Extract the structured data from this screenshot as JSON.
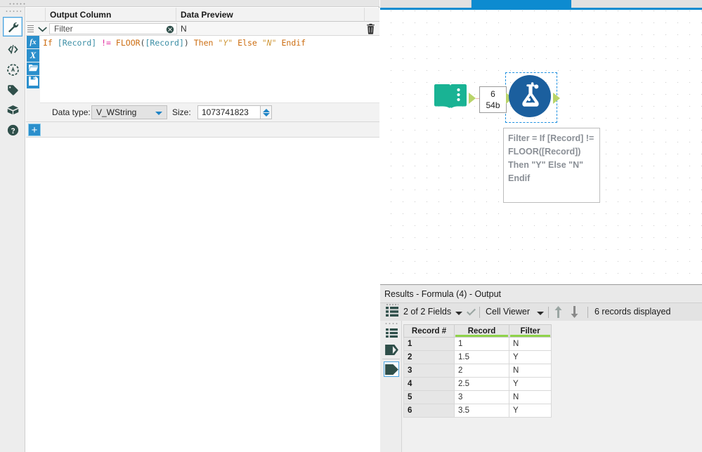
{
  "app": {
    "accent_blue": "#0d8bd0",
    "tool_blue": "#2b8fcc",
    "node_blue": "#1b5f9e",
    "node_green": "#19b394",
    "connector_green": "#b9d46a",
    "header_green": "#8fd34a"
  },
  "config": {
    "rail_icons": [
      {
        "name": "wrench-icon",
        "glyph": "wrench",
        "selected": true
      },
      {
        "name": "code-icon",
        "glyph": "code",
        "selected": false
      },
      {
        "name": "compass-icon",
        "glyph": "compass",
        "selected": false
      },
      {
        "name": "tag-icon",
        "glyph": "tag",
        "selected": false
      },
      {
        "name": "package-icon",
        "glyph": "package",
        "selected": false
      },
      {
        "name": "help-icon",
        "glyph": "question",
        "selected": false
      }
    ],
    "columns": {
      "output_column": "Output Column",
      "data_preview": "Data Preview"
    },
    "row": {
      "output_column_value": "Filter",
      "output_column_placeholder": "Filter",
      "data_preview_value": "N",
      "clear_icon": "clear-circle-icon",
      "delete_icon": "trash-icon",
      "expand_icon": "chevron-down-icon"
    },
    "editor_buttons": [
      {
        "name": "function-button",
        "label": "fx"
      },
      {
        "name": "variable-button",
        "label": "X"
      },
      {
        "name": "open-button",
        "label": "folder-icon"
      },
      {
        "name": "save-button",
        "label": "save-icon"
      }
    ],
    "formula": {
      "full_text": "If [Record] != FLOOR([Record]) Then \"Y\" Else \"N\" Endif",
      "tokens": [
        {
          "t": "If",
          "c": "kw"
        },
        {
          "t": " ",
          "c": "pl"
        },
        {
          "t": "[Record]",
          "c": "fld"
        },
        {
          "t": " ",
          "c": "pl"
        },
        {
          "t": "!=",
          "c": "op"
        },
        {
          "t": " ",
          "c": "pl"
        },
        {
          "t": "FLOOR",
          "c": "fn"
        },
        {
          "t": "(",
          "c": "pl"
        },
        {
          "t": "[Record]",
          "c": "fld"
        },
        {
          "t": ")",
          "c": "pl"
        },
        {
          "t": " ",
          "c": "pl"
        },
        {
          "t": "Then",
          "c": "kw"
        },
        {
          "t": " ",
          "c": "pl"
        },
        {
          "t": "\"Y\"",
          "c": "str"
        },
        {
          "t": " ",
          "c": "pl"
        },
        {
          "t": "Else",
          "c": "kw"
        },
        {
          "t": " ",
          "c": "pl"
        },
        {
          "t": "\"N\"",
          "c": "str"
        },
        {
          "t": " ",
          "c": "pl"
        },
        {
          "t": "Endif",
          "c": "kw"
        }
      ]
    },
    "datatype": {
      "label": "Data type:",
      "value": "V_WString",
      "size_label": "Size:",
      "size_value": "1073741823"
    },
    "add_button_label": "+"
  },
  "canvas": {
    "nodes": [
      {
        "name": "text-input-node",
        "icon": "book-icon",
        "color": "#19b394"
      },
      {
        "name": "formula-node",
        "icon": "flask-icon",
        "color": "#1b5f9e",
        "selected": true
      }
    ],
    "connection_label": {
      "records": "6",
      "size": "54b"
    },
    "annotation": "Filter = If [Record] != FLOOR([Record]) Then \"Y\" Else \"N\" Endif"
  },
  "results": {
    "title": "Results - Formula (4) - Output",
    "toolbar": {
      "grid_icon": "grid-list-icon",
      "fields": "2 of 2 Fields",
      "check_icon": "check-icon",
      "viewer": "Cell Viewer",
      "sort_up_icon": "arrow-up-icon",
      "sort_down_icon": "arrow-down-icon",
      "records": "6 records displayed"
    },
    "rail_icons": [
      {
        "name": "results-list-icon",
        "selected": false
      },
      {
        "name": "input-anchor-icon",
        "selected": false
      },
      {
        "name": "output-anchor-icon",
        "selected": true
      }
    ],
    "table": {
      "headers": [
        "Record #",
        "Record",
        "Filter"
      ],
      "rows": [
        [
          "1",
          "1",
          "N"
        ],
        [
          "2",
          "1.5",
          "Y"
        ],
        [
          "3",
          "2",
          "N"
        ],
        [
          "4",
          "2.5",
          "Y"
        ],
        [
          "5",
          "3",
          "N"
        ],
        [
          "6",
          "3.5",
          "Y"
        ]
      ]
    }
  }
}
